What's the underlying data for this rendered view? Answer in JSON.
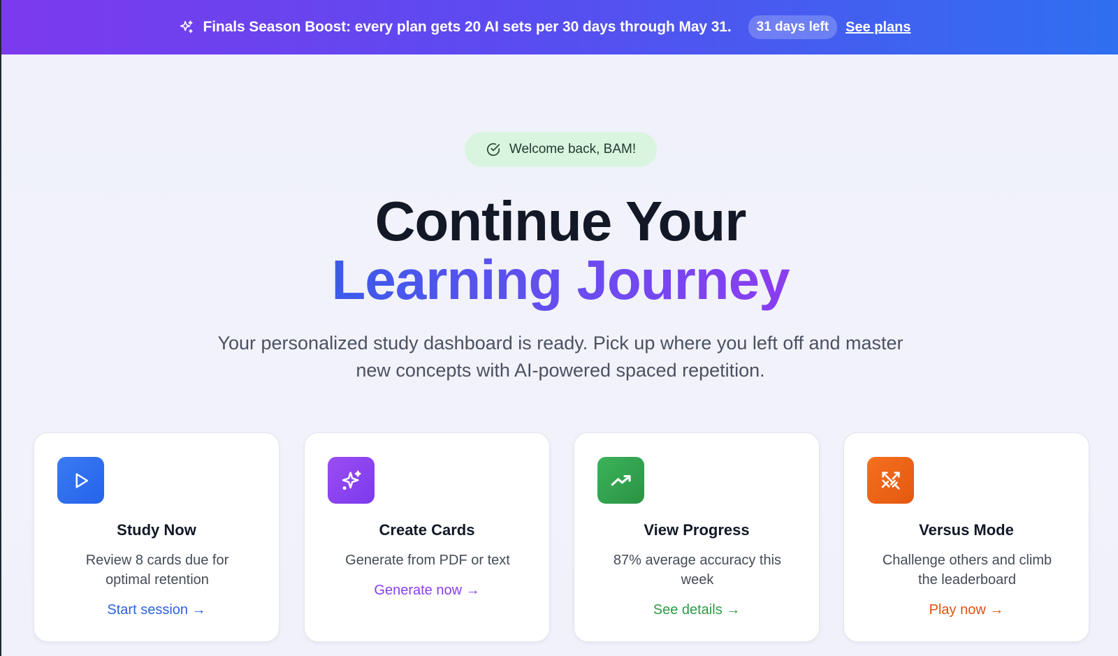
{
  "banner": {
    "icon": "sparkles-icon",
    "message": "Finals Season Boost: every plan gets 20 AI sets per 30 days through May 31.",
    "days_left": "31 days left",
    "link_label": "See plans"
  },
  "hero": {
    "welcome": "Welcome back, BAM!",
    "title_line1": "Continue Your",
    "title_line2": "Learning Journey",
    "subtitle": "Your personalized study dashboard is ready. Pick up where you left off and master new concepts with AI-powered spaced repetition."
  },
  "cards": [
    {
      "icon": "play-icon",
      "color": "#2f6ff0",
      "title": "Study Now",
      "description": "Review 8 cards due for optimal retention",
      "link": "Start session →"
    },
    {
      "icon": "sparkle-icon",
      "color": "#8b3df0",
      "title": "Create Cards",
      "description": "Generate from PDF or text",
      "link": "Generate now →"
    },
    {
      "icon": "trending-up-icon",
      "color": "#2f9e48",
      "title": "View Progress",
      "description": "87% average accuracy this week",
      "link": "See details →"
    },
    {
      "icon": "swords-icon",
      "color": "#ee5a12",
      "title": "Versus Mode",
      "description": "Challenge others and climb the leaderboard",
      "link": "Play now →"
    }
  ]
}
